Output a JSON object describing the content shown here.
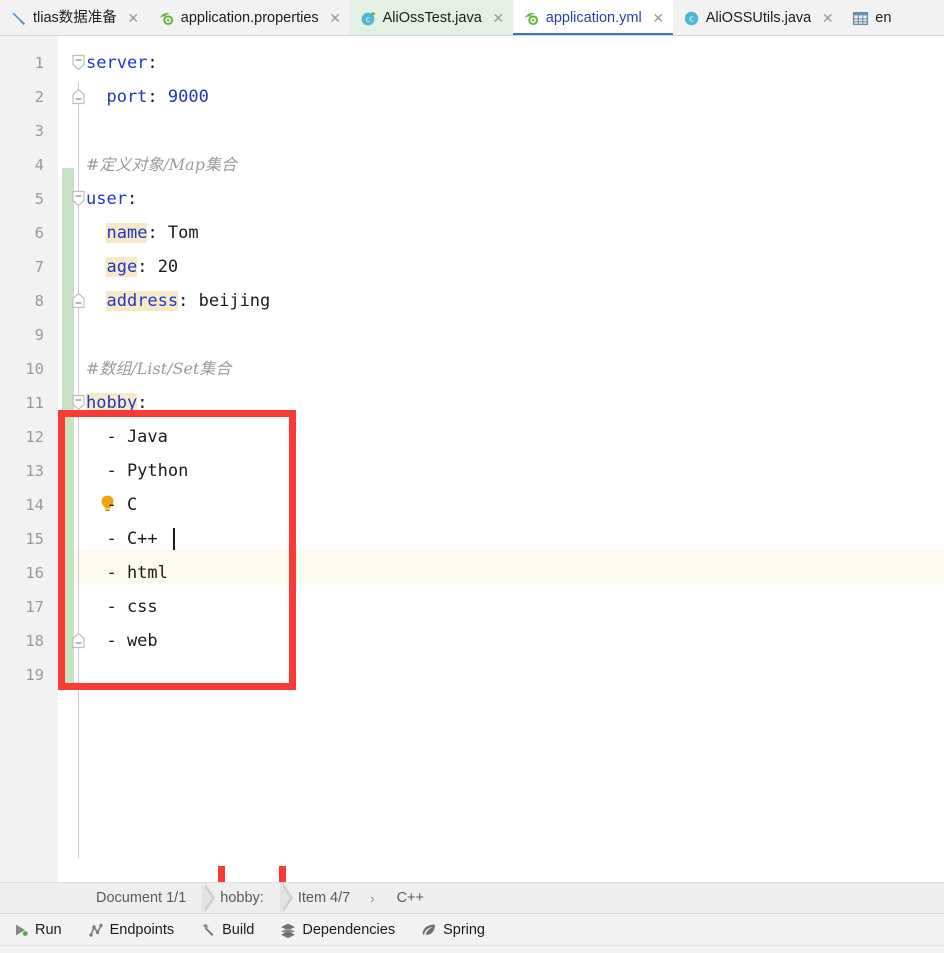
{
  "window": {
    "app": "IntelliJ IDEA",
    "theme_accent": "#3574d6",
    "annotation_color": "#fb3a34"
  },
  "tabs": [
    {
      "label": "tlias数据准备",
      "icon": "database-console-icon",
      "close": "✕",
      "state": "inactive"
    },
    {
      "label": "application.properties",
      "icon": "spring-properties-icon",
      "close": "✕",
      "state": "inactive"
    },
    {
      "label": "AliOssTest.java",
      "icon": "java-test-class-icon",
      "close": "✕",
      "state": "highlighted"
    },
    {
      "label": "application.yml",
      "icon": "spring-yaml-icon",
      "close": "✕",
      "state": "active"
    },
    {
      "label": "AliOSSUtils.java",
      "icon": "java-class-icon",
      "close": "✕",
      "state": "inactive"
    },
    {
      "label": "en",
      "icon": "table-icon",
      "close": "",
      "state": "inactive"
    }
  ],
  "editor": {
    "file": "application.yml",
    "current_line": 15,
    "caret_after": "C++",
    "lines": [
      {
        "n": "1",
        "indent": 0,
        "fold": "down",
        "segments": [
          {
            "t": "server",
            "c": "k"
          },
          {
            "t": ":",
            "c": "v"
          }
        ]
      },
      {
        "n": "2",
        "indent": 0,
        "fold": "up",
        "segments": [
          {
            "t": "  port",
            "c": "k"
          },
          {
            "t": ": ",
            "c": "v"
          },
          {
            "t": "9000",
            "c": "k"
          }
        ]
      },
      {
        "n": "3",
        "indent": 0,
        "fold": "",
        "segments": []
      },
      {
        "n": "4",
        "indent": 0,
        "fold": "",
        "segments": [
          {
            "t": "#定义对象/Map集合",
            "c": "cm"
          }
        ]
      },
      {
        "n": "5",
        "indent": 0,
        "fold": "down",
        "segments": [
          {
            "t": "user",
            "c": "k"
          },
          {
            "t": ":",
            "c": "v"
          }
        ]
      },
      {
        "n": "6",
        "indent": 0,
        "fold": "",
        "segments": [
          {
            "t": "  ",
            "c": "v"
          },
          {
            "t": "name",
            "c": "kv"
          },
          {
            "t": ": ",
            "c": "v"
          },
          {
            "t": "Tom",
            "c": "v"
          }
        ]
      },
      {
        "n": "7",
        "indent": 0,
        "fold": "",
        "segments": [
          {
            "t": "  ",
            "c": "v"
          },
          {
            "t": "age",
            "c": "kv"
          },
          {
            "t": ": ",
            "c": "v"
          },
          {
            "t": "20",
            "c": "v"
          }
        ]
      },
      {
        "n": "8",
        "indent": 0,
        "fold": "up",
        "segments": [
          {
            "t": "  ",
            "c": "v"
          },
          {
            "t": "address",
            "c": "kv"
          },
          {
            "t": ": ",
            "c": "v"
          },
          {
            "t": "beijing",
            "c": "v"
          }
        ]
      },
      {
        "n": "9",
        "indent": 0,
        "fold": "",
        "segments": []
      },
      {
        "n": "10",
        "indent": 0,
        "fold": "",
        "segments": [
          {
            "t": "#数组/List/Set集合",
            "c": "cm"
          }
        ]
      },
      {
        "n": "11",
        "indent": 0,
        "fold": "down",
        "segments": [
          {
            "t": "hobby",
            "c": "kv"
          },
          {
            "t": ":",
            "c": "v"
          }
        ]
      },
      {
        "n": "12",
        "indent": 0,
        "fold": "",
        "segments": [
          {
            "t": "  - Java",
            "c": "v"
          }
        ]
      },
      {
        "n": "13",
        "indent": 0,
        "fold": "",
        "segments": [
          {
            "t": "  - Python",
            "c": "v"
          }
        ]
      },
      {
        "n": "14",
        "indent": 0,
        "fold": "",
        "bulb": true,
        "segments": [
          {
            "t": "  - C",
            "c": "v"
          }
        ]
      },
      {
        "n": "15",
        "indent": 0,
        "fold": "",
        "caret": true,
        "segments": [
          {
            "t": "  - C++",
            "c": "v"
          }
        ]
      },
      {
        "n": "16",
        "indent": 0,
        "fold": "",
        "segments": [
          {
            "t": "  - html",
            "c": "v"
          }
        ]
      },
      {
        "n": "17",
        "indent": 0,
        "fold": "",
        "segments": [
          {
            "t": "  - css",
            "c": "v"
          }
        ]
      },
      {
        "n": "18",
        "indent": 0,
        "fold": "up",
        "segments": [
          {
            "t": "  - web",
            "c": "v"
          }
        ]
      },
      {
        "n": "19",
        "indent": 0,
        "fold": "",
        "segments": []
      }
    ]
  },
  "breadcrumb": [
    {
      "label": "Document 1/1",
      "sep": "arrow"
    },
    {
      "label": "hobby:",
      "sep": "arrow"
    },
    {
      "label": "Item 4/7",
      "sep": "chevron"
    },
    {
      "label": "C++",
      "sep": ""
    }
  ],
  "breadcrumb_chevron": "›",
  "statusbar": [
    {
      "label": "Run",
      "icon": "run-icon"
    },
    {
      "label": "Endpoints",
      "icon": "endpoints-icon"
    },
    {
      "label": "Build",
      "icon": "build-hammer-icon"
    },
    {
      "label": "Dependencies",
      "icon": "dependencies-stack-icon"
    },
    {
      "label": "Spring",
      "icon": "spring-leaf-icon"
    }
  ]
}
